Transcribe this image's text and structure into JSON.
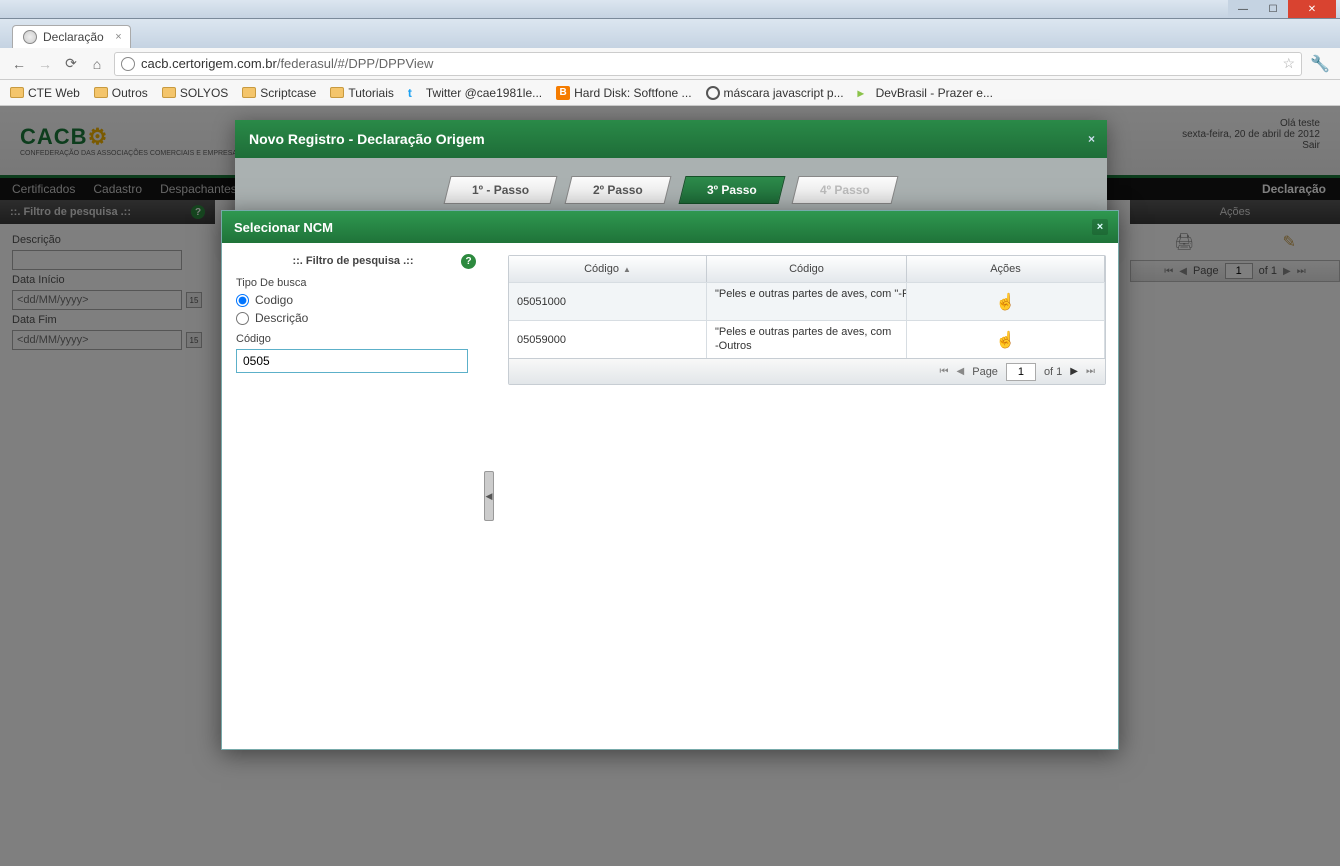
{
  "window": {
    "title": "Declaração"
  },
  "browser": {
    "url_host": "cacb.certorigem.com.br",
    "url_path": "/federasul/#/DPP/DPPView",
    "bookmarks": [
      {
        "label": "CTE Web",
        "type": "folder"
      },
      {
        "label": "Outros",
        "type": "folder"
      },
      {
        "label": "SOLYOS",
        "type": "folder"
      },
      {
        "label": "Scriptcase",
        "type": "folder"
      },
      {
        "label": "Tutoriais",
        "type": "folder"
      },
      {
        "label": "Twitter @cae1981le...",
        "type": "twitter"
      },
      {
        "label": "Hard Disk: Softfone ...",
        "type": "blogger"
      },
      {
        "label": "máscara javascript p...",
        "type": "gear"
      },
      {
        "label": "DevBrasil - Prazer e...",
        "type": "dev"
      }
    ]
  },
  "app": {
    "logo": "CACB",
    "logo_sub": "CONFEDERAÇÃO DAS ASSOCIAÇÕES COMERCIAIS E EMPRESARIAIS DO BRASIL",
    "greeting": "Olá teste",
    "date": "sexta-feira, 20 de abril de 2012",
    "logout": "Sair",
    "nav": [
      "Certificados",
      "Cadastro",
      "Despachantes"
    ],
    "nav_right": "Declaração"
  },
  "back_filter": {
    "title": "::. Filtro de pesquisa .::",
    "lbl_desc": "Descrição",
    "lbl_start": "Data Início",
    "lbl_end": "Data Fim",
    "placeholder_date": "<dd/MM/yyyy>"
  },
  "back_actions": {
    "title": "Ações",
    "page_label": "Page",
    "page_value": "1",
    "of": "of 1"
  },
  "dialog1": {
    "title": "Novo Registro - Declaração Origem",
    "steps": [
      "1º - Passo",
      "2º Passo",
      "3º Passo",
      "4º Passo"
    ],
    "active_step": 2
  },
  "dialog2": {
    "title": "Selecionar NCM",
    "filter_title": "::. Filtro de pesquisa .::",
    "lbl_tipo": "Tipo De busca",
    "radio_codigo": "Codigo",
    "radio_desc": "Descrição",
    "lbl_codigo": "Código",
    "codigo_value": "0505",
    "grid": {
      "col_code": "Código",
      "col_desc": "Código",
      "col_act": "Ações",
      "rows": [
        {
          "code": "05051000",
          "desc": "\"Peles e outras partes de aves, com \"-Penas dos tipos utilizados para en"
        },
        {
          "code": "05059000",
          "desc": "\"Peles e outras partes de aves, com -Outros"
        }
      ],
      "page_label": "Page",
      "page_value": "1",
      "of": "of 1"
    }
  }
}
